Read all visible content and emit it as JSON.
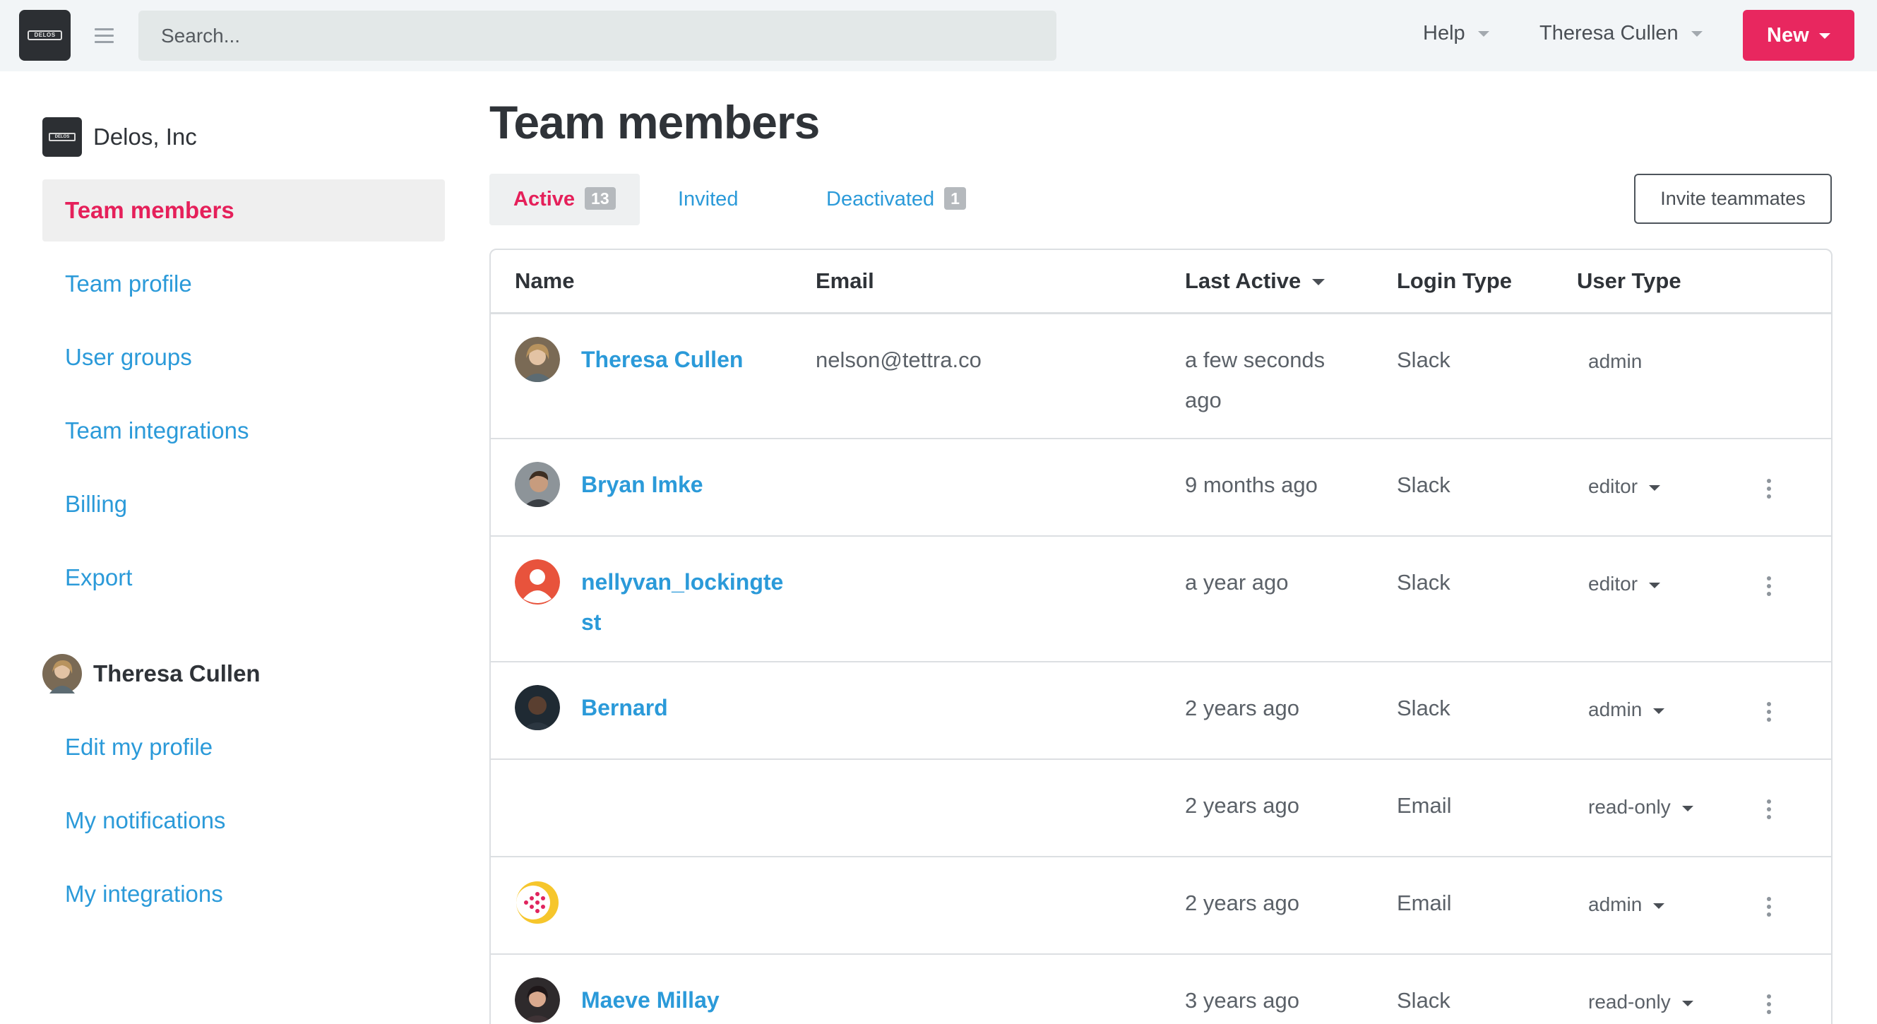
{
  "topbar": {
    "logo_text": "DELOS",
    "search_placeholder": "Search...",
    "help_label": "Help",
    "user_label": "Theresa Cullen",
    "new_label": "New"
  },
  "sidebar": {
    "org_logo_text": "DELOS",
    "org_name": "Delos, Inc",
    "team_items": [
      {
        "label": "Team members",
        "active": true
      },
      {
        "label": "Team profile"
      },
      {
        "label": "User groups"
      },
      {
        "label": "Team integrations"
      },
      {
        "label": "Billing"
      },
      {
        "label": "Export"
      }
    ],
    "user_name": "Theresa Cullen",
    "user_items": [
      {
        "label": "Edit my profile"
      },
      {
        "label": "My notifications"
      },
      {
        "label": "My integrations"
      }
    ]
  },
  "main": {
    "title": "Team members",
    "tabs": [
      {
        "label": "Active",
        "count": "13",
        "active": true
      },
      {
        "label": "Invited"
      },
      {
        "label": "Deactivated",
        "count": "1"
      }
    ],
    "invite_label": "Invite teammates",
    "columns": {
      "name": "Name",
      "email": "Email",
      "last_active": "Last Active",
      "login_type": "Login Type",
      "user_type": "User Type"
    },
    "rows": [
      {
        "name": "Theresa Cullen",
        "email": "nelson@tettra.co",
        "last_active": "a few seconds ago",
        "login": "Slack",
        "user_type": "admin"
      },
      {
        "name": "Bryan Imke",
        "email": "",
        "last_active": "9 months ago",
        "login": "Slack",
        "user_type": "editor"
      },
      {
        "name": "nellyvan_lockingtest",
        "email": "",
        "last_active": "a year ago",
        "login": "Slack",
        "user_type": "editor"
      },
      {
        "name": "Bernard",
        "email": "",
        "last_active": "2 years ago",
        "login": "Slack",
        "user_type": "admin"
      },
      {
        "name": "",
        "email": "",
        "last_active": "2 years ago",
        "login": "Email",
        "user_type": "read-only"
      },
      {
        "name": "",
        "email": "",
        "last_active": "2 years ago",
        "login": "Email",
        "user_type": "admin"
      },
      {
        "name": "Maeve Millay",
        "email": "",
        "last_active": "3 years ago",
        "login": "Slack",
        "user_type": "read-only"
      }
    ]
  },
  "colors": {
    "accent": "#e8275f",
    "link": "#2b9ad9",
    "topbar_bg": "#f2f5f7"
  }
}
